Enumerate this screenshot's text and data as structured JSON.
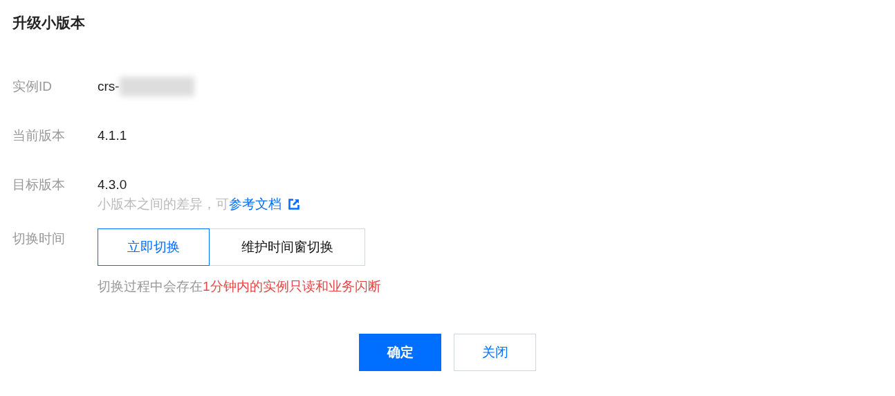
{
  "title": "升级小版本",
  "fields": [
    {
      "kind": "id",
      "label": "实例ID",
      "value": "crs-"
    },
    {
      "kind": "text",
      "label": "当前版本",
      "value": "4.1.1"
    },
    {
      "kind": "version",
      "label": "目标版本",
      "value": "4.3.0",
      "hint": "小版本之间的差异，可",
      "link": "参考文档"
    },
    {
      "kind": "switch",
      "label": "切换时间",
      "options": [
        {
          "label": "立即切换",
          "selected": true
        },
        {
          "label": "维护时间窗切换",
          "selected": false
        }
      ],
      "note": "切换过程中会存在",
      "warning": "1分钟内的实例只读和业务闪断"
    }
  ],
  "buttons": [
    {
      "label": "确定",
      "kind": "primary"
    },
    {
      "label": "关闭",
      "kind": "default"
    }
  ]
}
